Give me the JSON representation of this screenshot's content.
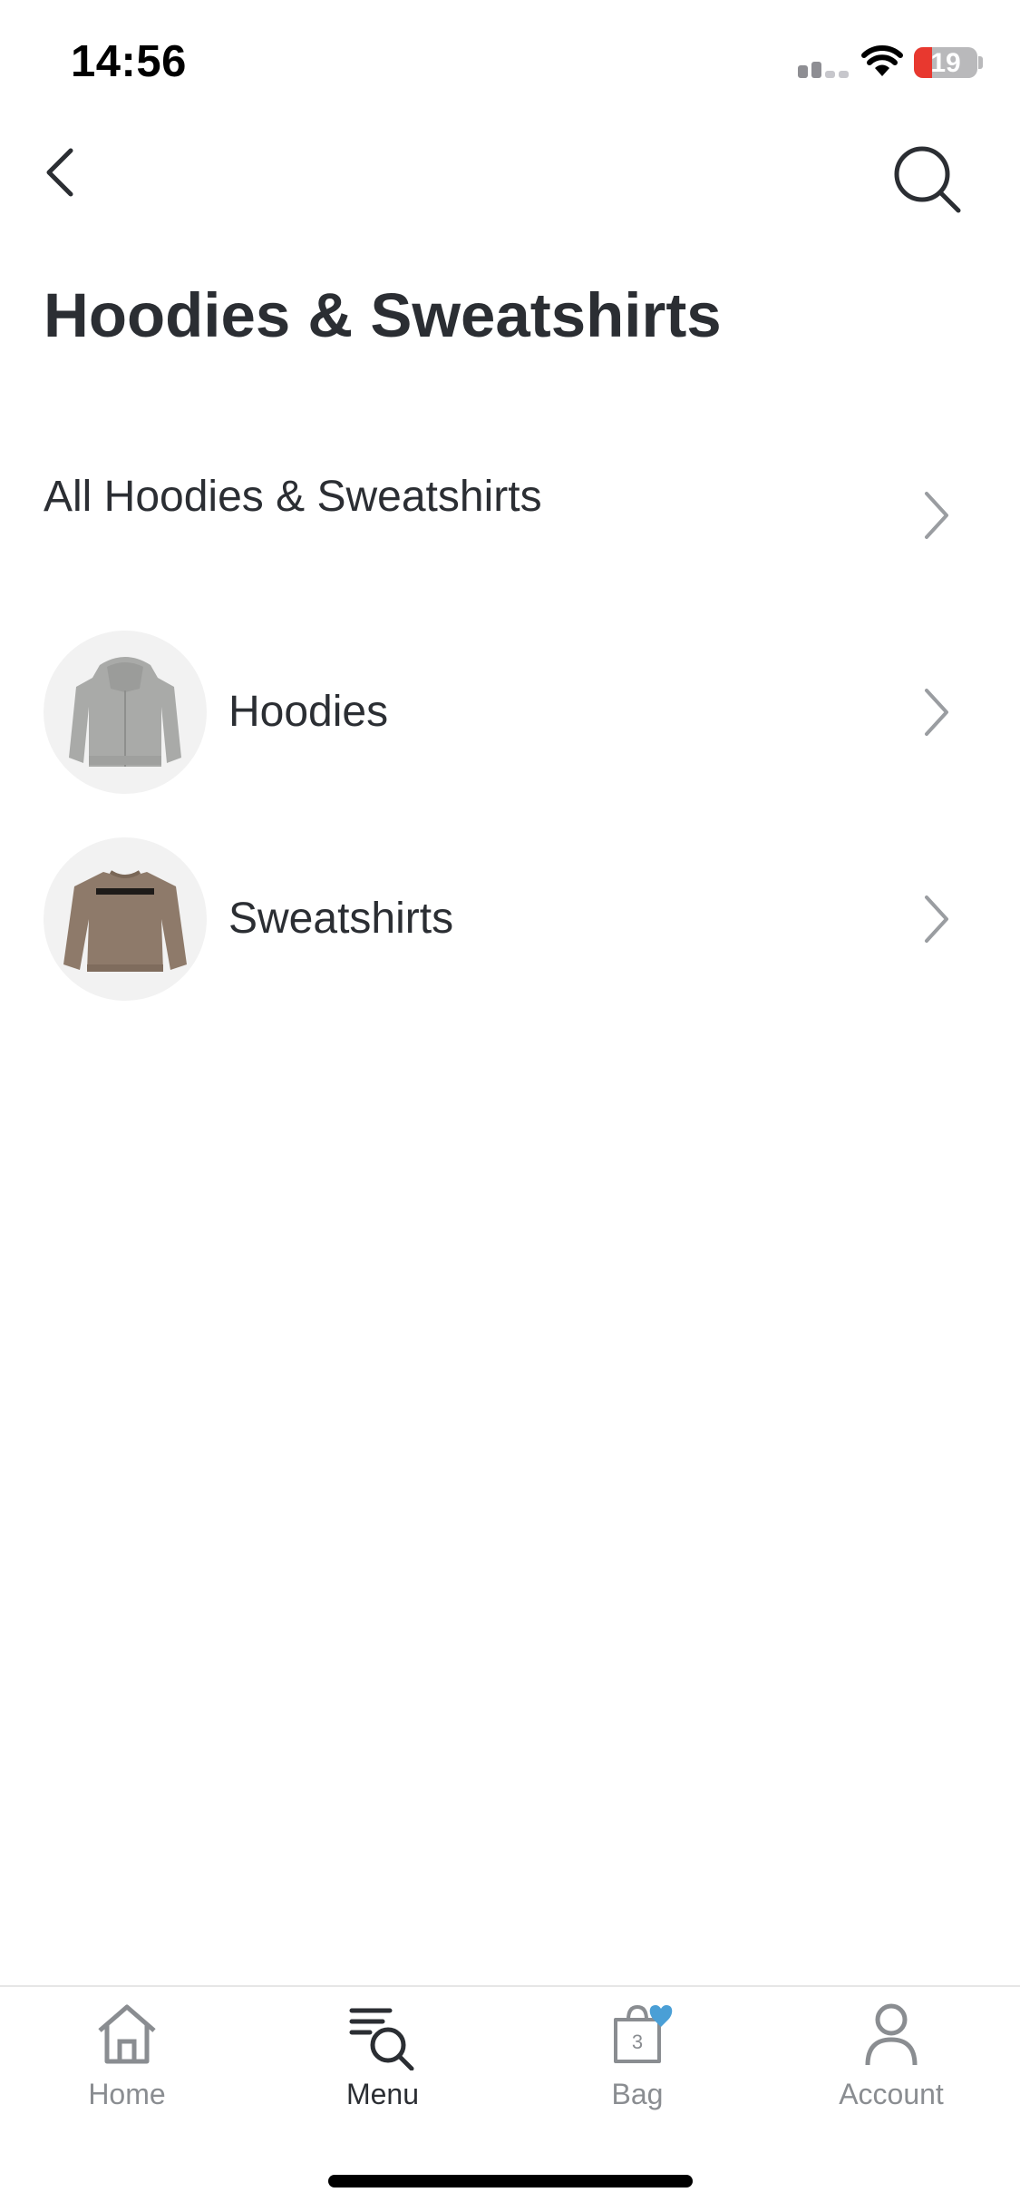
{
  "status_bar": {
    "time": "14:56",
    "battery": "19"
  },
  "header": {
    "title": "Hoodies & Sweatshirts"
  },
  "list": {
    "all_label": "All Hoodies & Sweatshirts",
    "items": [
      {
        "label": "Hoodies",
        "image": "grey-zip-hoodie"
      },
      {
        "label": "Sweatshirts",
        "image": "brown-crewneck-sweatshirt"
      }
    ]
  },
  "tabbar": {
    "tabs": [
      {
        "label": "Home",
        "icon": "home-icon"
      },
      {
        "label": "Menu",
        "icon": "menu-search-icon",
        "active": true
      },
      {
        "label": "Bag",
        "icon": "bag-icon",
        "badge": "3"
      },
      {
        "label": "Account",
        "icon": "account-icon"
      }
    ]
  },
  "colors": {
    "text": "#2b2e33",
    "inactive": "#8a8d91",
    "accent": "#4a9fd6",
    "battery_low": "#e8382f"
  }
}
